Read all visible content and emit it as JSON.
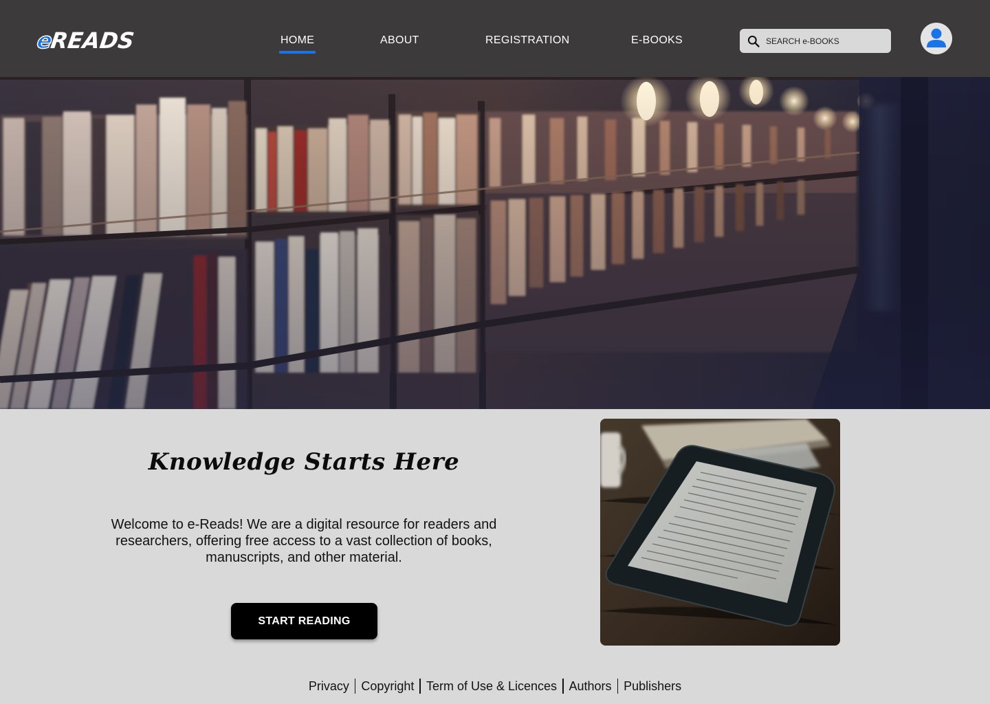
{
  "brand": {
    "logo_e": "e",
    "logo_rest": "READS",
    "accent_color": "#1a73e8",
    "header_bg": "#3c3a3b"
  },
  "nav": {
    "items": [
      {
        "label": "HOME",
        "active": true
      },
      {
        "label": "ABOUT",
        "active": false
      },
      {
        "label": "REGISTRATION",
        "active": false
      },
      {
        "label": "E-BOOKS",
        "active": false
      }
    ]
  },
  "search": {
    "placeholder": "SEARCH e-BOOKS",
    "value": "",
    "icon": "search-icon"
  },
  "user": {
    "icon": "user-avatar-icon"
  },
  "hero": {
    "image": "library-bookshelves-photo"
  },
  "main": {
    "headline": "Knowledge Starts Here",
    "intro": "Welcome to e-Reads! We are a digital resource for readers and researchers, offering free access to a vast collection of books, manuscripts, and other material.",
    "cta_label": "START READING",
    "side_image": "ereader-on-table-photo"
  },
  "footer": {
    "links": [
      "Privacy",
      "Copyright",
      "Term of Use & Licences",
      "Authors",
      "Publishers"
    ]
  }
}
